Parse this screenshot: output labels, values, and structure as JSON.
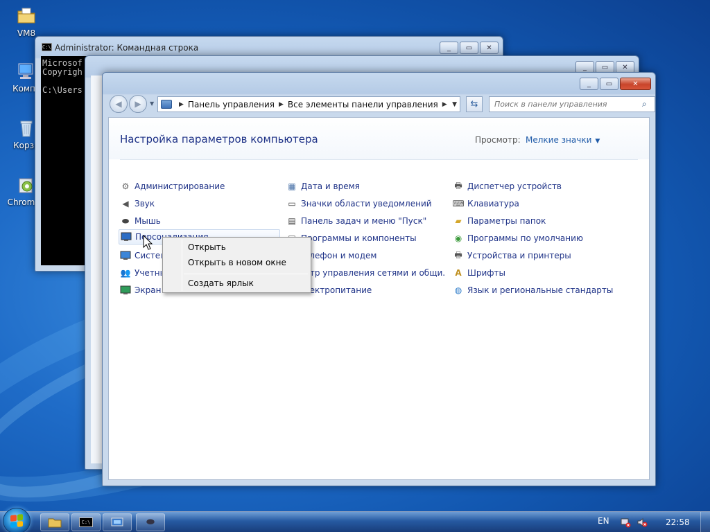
{
  "desktop": {
    "icons": [
      {
        "label": "VM8"
      },
      {
        "label": "Компь"
      },
      {
        "label": "Корзи"
      },
      {
        "label": "ChromeS"
      }
    ]
  },
  "cmd_window": {
    "title": "Administrator: Командная строка",
    "lines": [
      "Microsof",
      "Copyrigh",
      "",
      "C:\\Users"
    ]
  },
  "control_panel": {
    "breadcrumb": [
      "Панель управления",
      "Все элементы панели управления"
    ],
    "search_placeholder": "Поиск в панели управления",
    "page_title": "Настройка параметров компьютера",
    "view_label": "Просмотр:",
    "view_value": "Мелкие значки",
    "columns": [
      [
        "Администрирование",
        "Звук",
        "Мышь",
        "Персонализация",
        "Система",
        "Учетные",
        "Экран"
      ],
      [
        "Дата и время",
        "Значки области уведомлений",
        "Панель задач и меню \"Пуск\"",
        "Программы и компоненты",
        "елефон и модем",
        "нтр управления сетями и общи...",
        "лектропитание"
      ],
      [
        "Диспетчер устройств",
        "Клавиатура",
        "Параметры папок",
        "Программы по умолчанию",
        "Устройства и принтеры",
        "Шрифты",
        "Язык и региональные стандарты"
      ]
    ]
  },
  "context_menu": {
    "items": [
      "Открыть",
      "Открыть в новом окне",
      "Создать ярлык"
    ]
  },
  "taskbar": {
    "language": "EN",
    "clock": "22:58"
  },
  "colors": {
    "link_blue": "#1e3287",
    "accent_blue": "#1e5aa8"
  }
}
